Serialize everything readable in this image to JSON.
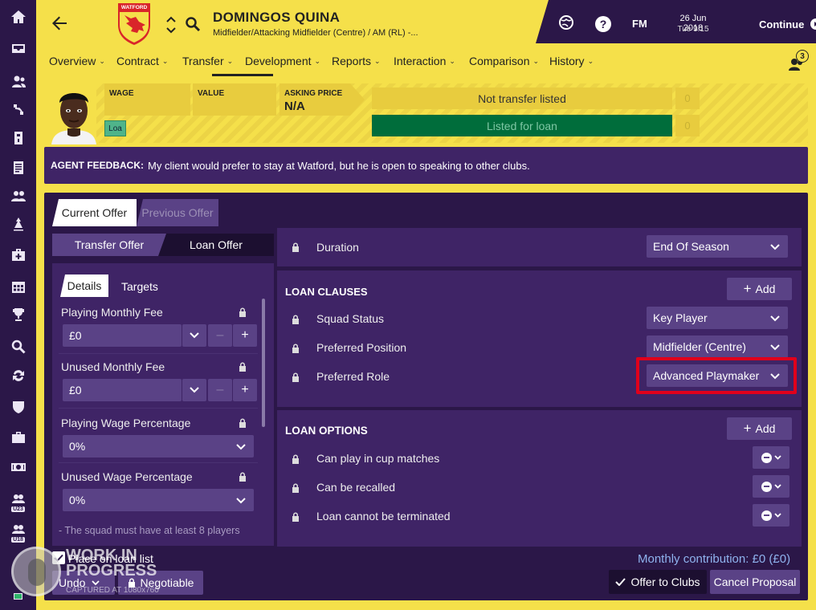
{
  "sidebar": {
    "icons": [
      "home-icon",
      "inbox-icon",
      "squad-icon",
      "tactics-icon",
      "data-hub-icon",
      "reports-icon",
      "staff-icon",
      "training-icon",
      "medical-icon",
      "schedule-icon",
      "competitions-icon",
      "scouting-icon",
      "transfers-icon",
      "club-vision-icon",
      "finances-icon",
      "dev-centre-icon"
    ],
    "u23_label": "U23",
    "u18_label": "U18"
  },
  "header": {
    "player_name": "DOMINGOS QUINA",
    "player_position": "Midfielder/Attacking Midfielder (Centre) / AM (RL) -...",
    "club_badge_label": "WATFORD",
    "date": "26 Jun 2018",
    "time": "Tue 9:15",
    "fm_label": "FM",
    "continue_label": "Continue",
    "notification_count": "3"
  },
  "nav_tabs": [
    {
      "label": "Overview"
    },
    {
      "label": "Contract"
    },
    {
      "label": "Transfer"
    },
    {
      "label": "Development"
    },
    {
      "label": "Reports"
    },
    {
      "label": "Interaction"
    },
    {
      "label": "Comparison"
    },
    {
      "label": "History"
    }
  ],
  "stats": {
    "wage_label": "WAGE",
    "value_label": "VALUE",
    "asking_price_label": "ASKING PRICE",
    "asking_price_value": "N/A",
    "loan_badge": "Loa",
    "not_transfer_listed": "Not transfer listed",
    "listed_for_loan": "Listed for loan",
    "count_1": "0",
    "count_2": "0"
  },
  "agent": {
    "label": "AGENT FEEDBACK:",
    "text": "My client would prefer to stay at Watford, but he is open to speaking to other clubs."
  },
  "offer_tabs": {
    "current": "Current Offer",
    "previous": "Previous Offer"
  },
  "offer_type": {
    "transfer": "Transfer Offer",
    "loan": "Loan Offer"
  },
  "details_tabs": {
    "details": "Details",
    "targets": "Targets"
  },
  "fees": {
    "playing_monthly_fee_label": "Playing Monthly Fee",
    "playing_monthly_fee_value": "£0",
    "unused_monthly_fee_label": "Unused Monthly Fee",
    "unused_monthly_fee_value": "£0",
    "playing_wage_pct_label": "Playing Wage Percentage",
    "playing_wage_pct_value": "0%",
    "unused_wage_pct_label": "Unused Wage Percentage",
    "unused_wage_pct_value": "0%",
    "squad_note": "- The squad must have at least 8 players"
  },
  "duration": {
    "label": "Duration",
    "value": "End Of Season"
  },
  "loan_clauses": {
    "title": "LOAN CLAUSES",
    "add_label": "Add",
    "rows": [
      {
        "label": "Squad Status",
        "value": "Key Player"
      },
      {
        "label": "Preferred Position",
        "value": "Midfielder (Centre)"
      },
      {
        "label": "Preferred Role",
        "value": "Advanced Playmaker"
      }
    ]
  },
  "loan_options": {
    "title": "LOAN OPTIONS",
    "add_label": "Add",
    "rows": [
      {
        "label": "Can play in cup matches"
      },
      {
        "label": "Can be recalled"
      },
      {
        "label": "Loan cannot be terminated"
      }
    ]
  },
  "footer": {
    "place_on_loan_list": "Place on loan list",
    "undo_label": "Undo",
    "negotiable_label": "Negotiable",
    "monthly_contribution": "Monthly contribution: £0 (£0)",
    "offer_to_clubs": "Offer to Clubs",
    "cancel_proposal": "Cancel Proposal"
  },
  "watermark": {
    "line1": "WORK IN",
    "line2": "PROGRESS",
    "line3": "CAPTURED AT 1080x760"
  },
  "colors": {
    "primary_purple": "#2b1748",
    "secondary_purple": "#3f2466",
    "yellow": "#f5e04a",
    "green": "#006d3b",
    "highlight_red": "#e0001b"
  }
}
